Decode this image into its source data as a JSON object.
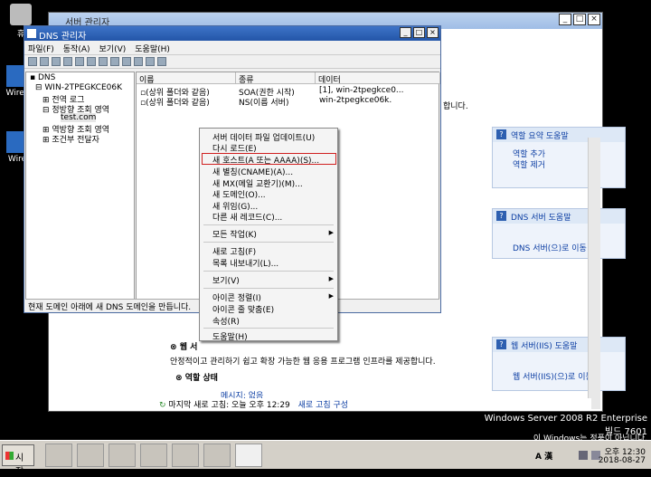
{
  "desktop": {
    "icons": [
      {
        "label": "휴"
      },
      {
        "label": "Wires"
      },
      {
        "label": "Wire"
      }
    ],
    "watermark": {
      "line1": "Windows Server 2008 R2 Enterprise",
      "line2": "빌드 7601",
      "line3": "이 Windows는 정품이 아닙니다."
    }
  },
  "server_manager": {
    "title": "서버 관리자",
    "header_text": "합니다.",
    "panels": [
      {
        "title": "역할 요약 도움말",
        "links": [
          "역할 추가",
          "역할 제거"
        ]
      },
      {
        "title": "DNS 서버 도움말",
        "links": [
          "DNS 서버(으)로 이동"
        ]
      },
      {
        "title": "웹 서버(IIS) 도움말",
        "links": [
          "웹 서버(IIS)(으)로 이동"
        ]
      }
    ],
    "web_section_prefix": "웹 서",
    "web_desc": "안정적이고 관리하기 쉽고 확장 가능한 웹 응용 프로그램 인프라를 제공합니다.",
    "role_status": "역할 상태",
    "messages": "메시지: 없음",
    "status_bar": {
      "text": "마지막 새로 고침: 오늘 오후 12:29",
      "link": "새로 고침 구성"
    }
  },
  "dns_manager": {
    "title": "DNS 관리자",
    "menu": [
      "파일(F)",
      "동작(A)",
      "보기(V)",
      "도움말(H)"
    ],
    "tree": [
      "DNS",
      "WIN-2TPEGKCE06K",
      "전역 로그",
      "정방향 조회 영역",
      "test.com",
      "역방향 조회 영역",
      "조건부 전달자"
    ],
    "columns": [
      "이름",
      "종류",
      "데이터"
    ],
    "rows": [
      [
        "(상위 폴더와 같음)",
        "SOA(권한 시작)",
        "[1], win-2tpegkce0..."
      ],
      [
        "(상위 폴더와 같음)",
        "NS(이름 서버)",
        "win-2tpegkce06k."
      ]
    ],
    "status": "현재 도메인 아래에 새 DNS 도메인을 만듭니다."
  },
  "context_menu": {
    "items": [
      {
        "label": "서버 데이터 파일 업데이트(U)"
      },
      {
        "label": "다시 로드(E)"
      },
      {
        "label": "새 호스트(A 또는 AAAA)(S)...",
        "highlighted": true
      },
      {
        "label": "새 별칭(CNAME)(A)..."
      },
      {
        "label": "새 MX(메일 교환기)(M)..."
      },
      {
        "label": "새 도메인(O)..."
      },
      {
        "label": "새 위임(G)..."
      },
      {
        "label": "다른 새 레코드(C)..."
      },
      {
        "label": "모든 작업(K)",
        "submenu": true
      },
      {
        "label": "새로 고침(F)"
      },
      {
        "label": "목록 내보내기(L)..."
      },
      {
        "label": "보기(V)",
        "submenu": true
      },
      {
        "label": "아이콘 정렬(I)",
        "submenu": true
      },
      {
        "label": "아이콘 줄 맞춤(E)"
      },
      {
        "label": "속성(R)"
      },
      {
        "label": "도움말(H)"
      }
    ]
  },
  "taskbar": {
    "start": "시작",
    "tray_ime": "A 漢",
    "clock_time": "오후 12:30",
    "clock_date": "2018-08-27"
  }
}
